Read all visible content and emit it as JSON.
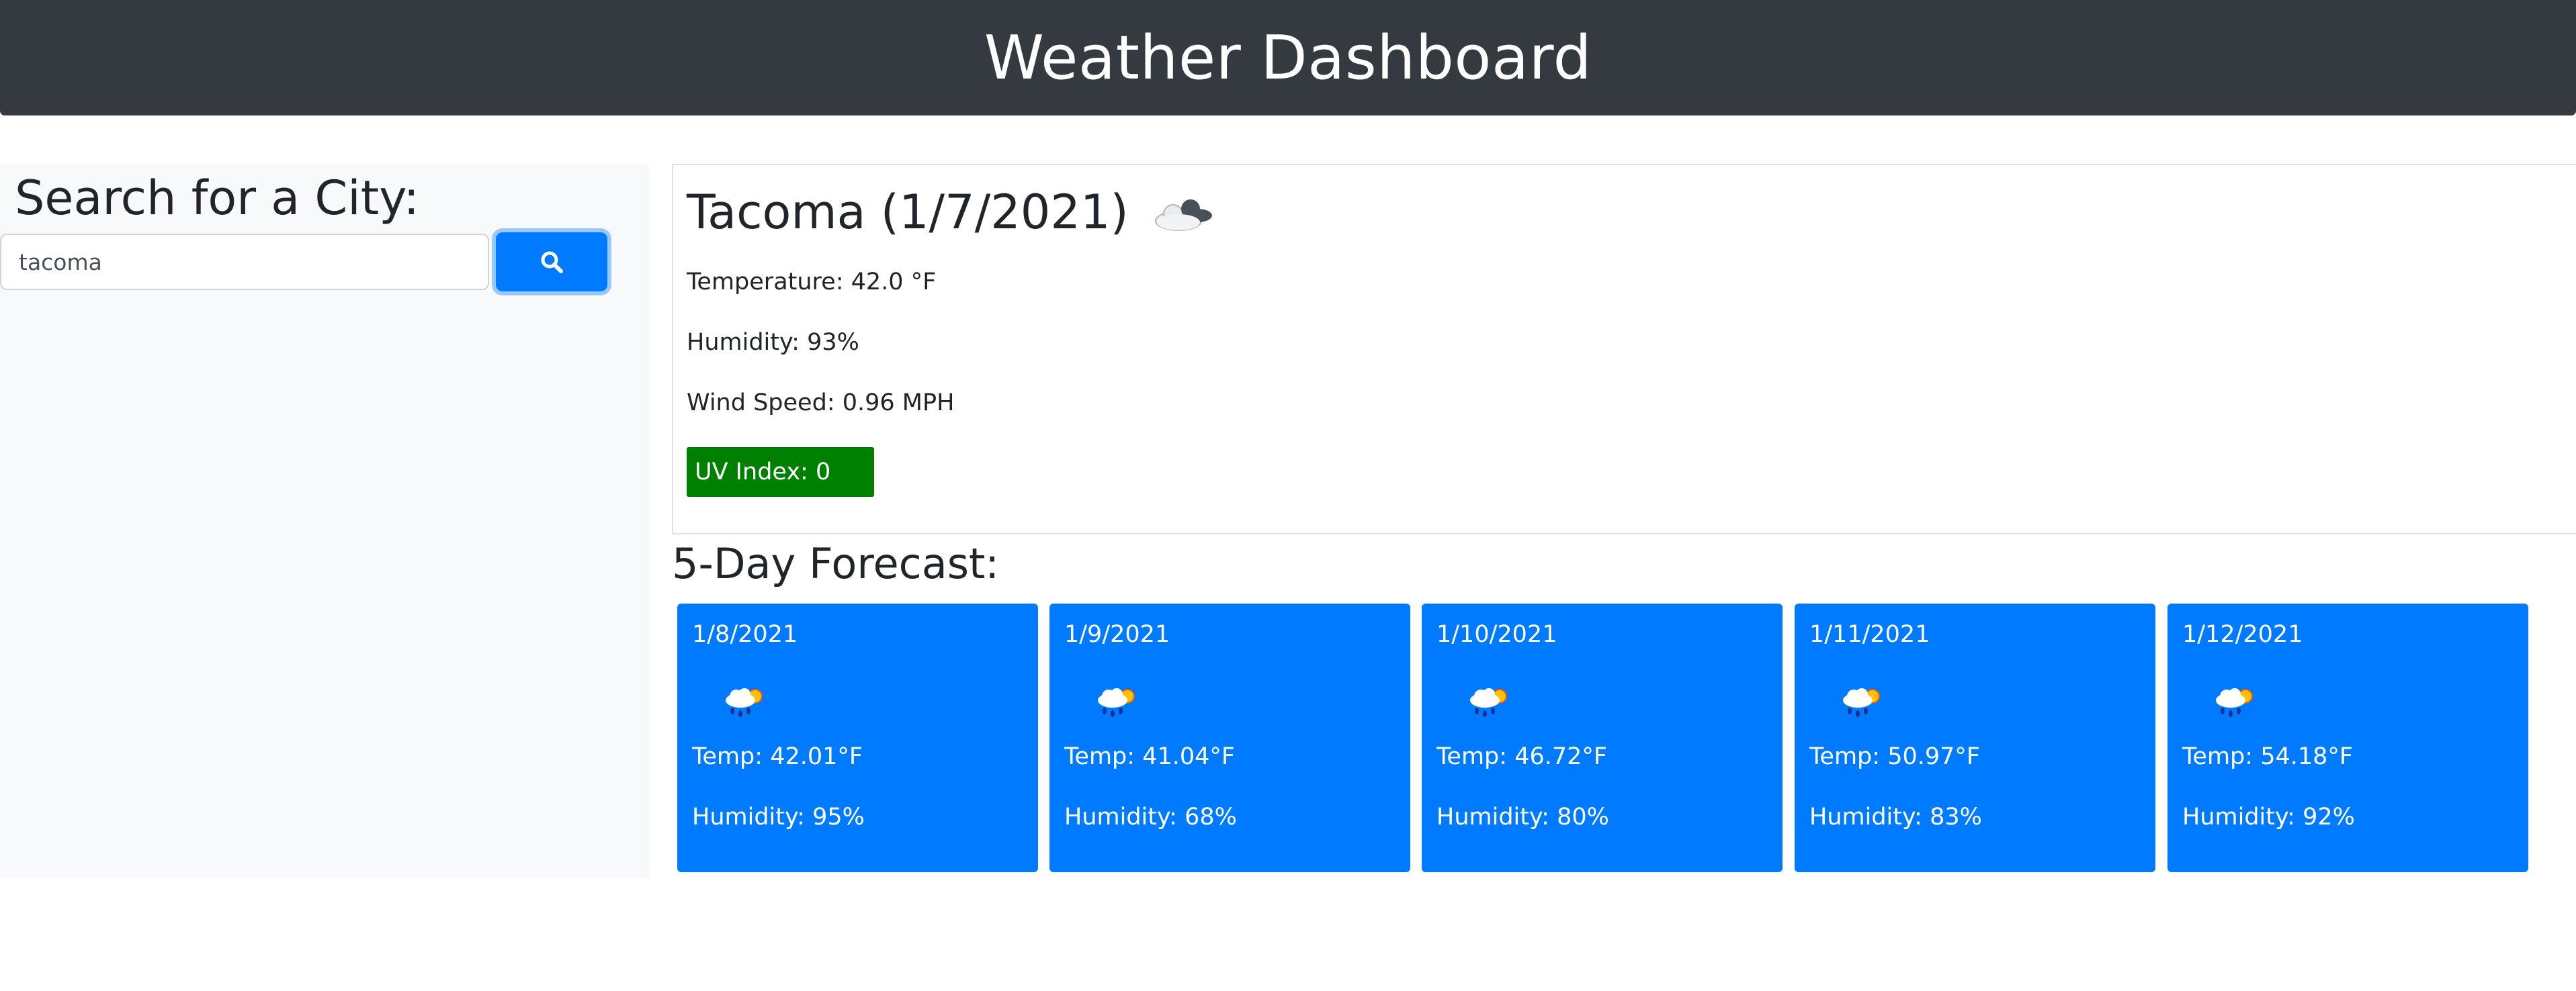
{
  "header": {
    "title": "Weather Dashboard"
  },
  "search": {
    "heading": "Search for a City:",
    "value": "tacoma",
    "button_icon": "search-icon"
  },
  "current": {
    "city_date": "Tacoma (1/7/2021)",
    "icon": "cloudy-icon",
    "temperature": "Temperature: 42.0 °F",
    "humidity": "Humidity: 93%",
    "wind": "Wind Speed: 0.96 MPH",
    "uv": "UV Index: 0",
    "uv_color": "#008000"
  },
  "forecast": {
    "title": "5-Day Forecast:",
    "days": [
      {
        "date": "1/8/2021",
        "icon": "rain-sun-icon",
        "temp": "Temp: 42.01°F",
        "humidity": "Humidity: 95%"
      },
      {
        "date": "1/9/2021",
        "icon": "rain-sun-icon",
        "temp": "Temp: 41.04°F",
        "humidity": "Humidity: 68%"
      },
      {
        "date": "1/10/2021",
        "icon": "rain-sun-icon",
        "temp": "Temp: 46.72°F",
        "humidity": "Humidity: 80%"
      },
      {
        "date": "1/11/2021",
        "icon": "rain-sun-icon",
        "temp": "Temp: 50.97°F",
        "humidity": "Humidity: 83%"
      },
      {
        "date": "1/12/2021",
        "icon": "rain-sun-icon",
        "temp": "Temp: 54.18°F",
        "humidity": "Humidity: 92%"
      }
    ]
  },
  "colors": {
    "header_bg": "#343a40",
    "accent": "#007bff",
    "sidebar_bg": "#f8f9fa"
  }
}
